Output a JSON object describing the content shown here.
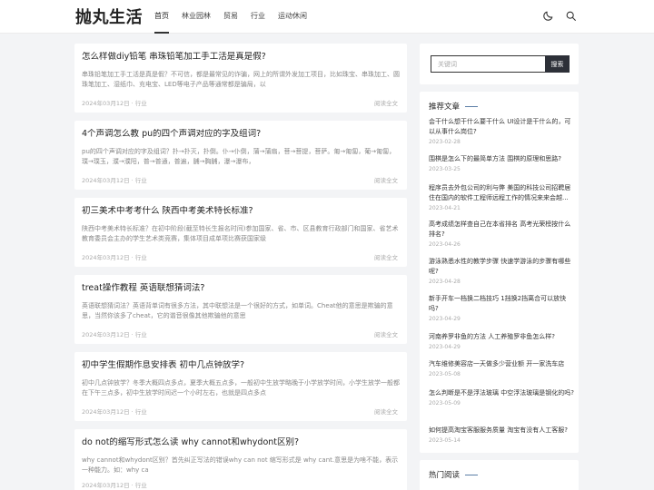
{
  "header": {
    "logo": "抛丸生活",
    "nav": [
      {
        "label": "首页",
        "active": true
      },
      {
        "label": "林业园林",
        "active": false
      },
      {
        "label": "贸易",
        "active": false
      },
      {
        "label": "行业",
        "active": false
      },
      {
        "label": "运动休闲",
        "active": false
      }
    ],
    "icons": [
      "moon-icon",
      "search-icon"
    ]
  },
  "articles": [
    {
      "title": "怎么样做diy铅笔 串珠铅笔加工手工活是真是假?",
      "excerpt": "串珠铅笔加工手工活是真是假？不可信，都是最常见的诈骗，网上的所谓外发加工项目，比如珠宝、串珠加工、圆珠笔加工、湿纸巾、充电宝、LED等电子产品等通常都是骗局，以",
      "date": "2024年03月12日",
      "category": "行业",
      "more": "阅读全文"
    },
    {
      "title": "4个声调怎么教 pu的四个声调对应的字及组词?",
      "excerpt": "pu的四个声调对应的字及组词？扑→扑灭，扑倒。仆→仆倒，蒲→蒲扇，菩→菩提，菩萨。匍→匍匐，葡→匍匐，璞→璞玉，濮→濮阳，普→普通，普遍，脯→胸脯，瀑→瀑布，",
      "date": "2024年03月12日",
      "category": "行业",
      "more": "阅读全文"
    },
    {
      "title": "初三美术中考考什么 陕西中考美术特长标准?",
      "excerpt": "陕西中考美术特长标准？在初中阶段(截至特长生报名时间)参加国家、省、市、区县教育行政部门和国家、省艺术教育委员会主办的学生艺术类竞赛，集体项目成单项比赛获国家级",
      "date": "2024年03月12日",
      "category": "行业",
      "more": "阅读全文"
    },
    {
      "title": "treat操作教程 英语联想猜词法?",
      "excerpt": "英语联想猜词法？英语背单词有很多方法，其中联想法是一个很好的方式，如单词。Cheat他的意思是欺骗的意思，当然你该多了cheat，它的谐音很像其他欺骗他的意思",
      "date": "2024年03月12日",
      "category": "行业",
      "more": "阅读全文"
    },
    {
      "title": "初中学生假期作息安排表 初中几点钟放学?",
      "excerpt": "初中几点钟放学？冬季大概四点多点，夏季大概五点多，一般初中生放学略晚于小学放学时间，小学生放学一般都在下午三点多，初中生放学时间迟一个小时左右，也就是四点多点",
      "date": "2024年03月12日",
      "category": "行业",
      "more": "阅读全文"
    },
    {
      "title": "do not的缩写形式怎么读 why cannot和whydont区别?",
      "excerpt": "why cannot和whydont区别？首先纠正写法的错误why can not 缩写形式是 why cant.意思是为啥不能，表示一种能力。如：why ca",
      "date": "2024年03月12日",
      "category": "行业",
      "more": "阅读全文"
    }
  ],
  "search": {
    "placeholder": "关键词",
    "button": "搜索"
  },
  "recommended": {
    "title": "推荐文章",
    "items": [
      {
        "title": "会干什么想干什么要干什么 UI设计是干什么的，可以从事什么岗位?",
        "date": "2023-02-28"
      },
      {
        "title": "围棋是怎么下的最简单方法 围棋的原理和思路?",
        "date": "2023-03-25"
      },
      {
        "title": "程序员去外包公司的利与弊 美国的科技公司招聘居住在国内的软件工程师远程工作的情况来来会越...",
        "date": "2023-04-21"
      },
      {
        "title": "高考成绩怎样查自己在本省排名 高考光荣榜按什么排名?",
        "date": "2023-04-26"
      },
      {
        "title": "游泳熟悉水性的教学步骤 快速学游泳的步骤有哪些呢?",
        "date": "2023-04-28"
      },
      {
        "title": "新手开车一档换二档技巧 1挡换2挡离合可以放快吗?",
        "date": "2023-04-29"
      },
      {
        "title": "河南养罗非鱼的方法 人工养殖罗非鱼怎么样?",
        "date": "2023-04-29"
      },
      {
        "title": "汽车维修美容店一天做多少营业额 开一家洗车店",
        "date": "2023-05-08"
      },
      {
        "title": "怎么判断是不是浮法玻璃 中空浮法玻璃是钢化的吗?",
        "date": "2023-05-09"
      },
      {
        "title": "如何提高淘宝客服服务质量 淘宝有没有人工客服?",
        "date": "2023-05-14"
      }
    ]
  },
  "hot": {
    "title": "热门阅读"
  }
}
